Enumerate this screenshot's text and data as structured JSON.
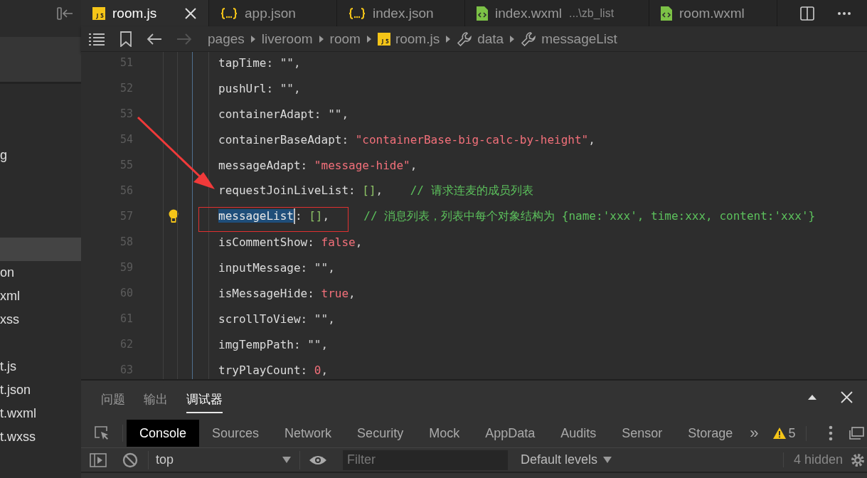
{
  "sidebar": {
    "rows": [
      {
        "label": "g",
        "selected": false
      },
      {
        "selected": true
      },
      {
        "label": "on",
        "selected": false
      },
      {
        "label": "xml",
        "selected": false
      },
      {
        "label": "xss",
        "selected": false
      },
      {
        "label": "t.js",
        "selected": false
      },
      {
        "label": "t.json",
        "selected": false
      },
      {
        "label": "t.wxml",
        "selected": false
      },
      {
        "label": "t.wxss",
        "selected": false
      }
    ]
  },
  "tabs": [
    {
      "label": "room.js",
      "kind": "js",
      "selected": true
    },
    {
      "label": "app.json",
      "kind": "json",
      "selected": false
    },
    {
      "label": "index.json",
      "kind": "json",
      "selected": false
    },
    {
      "label": "index.wxml",
      "detail": "...\\zb_list",
      "kind": "wxml",
      "selected": false
    },
    {
      "label": "room.wxml",
      "kind": "wxml",
      "selected": false
    }
  ],
  "breadcrumb": [
    {
      "label": "pages",
      "kind": "folder"
    },
    {
      "label": "liveroom",
      "kind": "folder"
    },
    {
      "label": "room",
      "kind": "folder"
    },
    {
      "label": "room.js",
      "kind": "js"
    },
    {
      "label": "data",
      "kind": "property"
    },
    {
      "label": "messageList",
      "kind": "property"
    }
  ],
  "editor": {
    "lines": [
      {
        "number": "51",
        "lightbulb": false,
        "tokens": [
          {
            "kind": "key",
            "text": "tapTime"
          },
          {
            "kind": "plain",
            "text": ": "
          },
          {
            "kind": "plain",
            "text": "\"\""
          },
          {
            "kind": "plain",
            "text": ","
          }
        ]
      },
      {
        "number": "52",
        "lightbulb": false,
        "tokens": [
          {
            "kind": "key",
            "text": "pushUrl"
          },
          {
            "kind": "plain",
            "text": ": "
          },
          {
            "kind": "plain",
            "text": "\"\""
          },
          {
            "kind": "plain",
            "text": ","
          }
        ]
      },
      {
        "number": "53",
        "lightbulb": false,
        "tokens": [
          {
            "kind": "key",
            "text": "containerAdapt"
          },
          {
            "kind": "plain",
            "text": ": "
          },
          {
            "kind": "plain",
            "text": "\"\""
          },
          {
            "kind": "plain",
            "text": ","
          }
        ]
      },
      {
        "number": "54",
        "lightbulb": false,
        "tokens": [
          {
            "kind": "key",
            "text": "containerBaseAdapt"
          },
          {
            "kind": "plain",
            "text": ": "
          },
          {
            "kind": "string",
            "text": "\"containerBase-big-calc-by-height\""
          },
          {
            "kind": "plain",
            "text": ","
          }
        ]
      },
      {
        "number": "55",
        "lightbulb": false,
        "tokens": [
          {
            "kind": "key",
            "text": "messageAdapt"
          },
          {
            "kind": "plain",
            "text": ": "
          },
          {
            "kind": "string",
            "text": "\"message-hide\""
          },
          {
            "kind": "plain",
            "text": ","
          }
        ]
      },
      {
        "number": "56",
        "lightbulb": false,
        "tokens": [
          {
            "kind": "key",
            "text": "requestJoinLiveList"
          },
          {
            "kind": "plain",
            "text": ": "
          },
          {
            "kind": "array",
            "text": "[]"
          },
          {
            "kind": "plain",
            "text": ",    "
          },
          {
            "kind": "comment",
            "text": "// 请求连麦的成员列表"
          }
        ]
      },
      {
        "number": "57",
        "lightbulb": true,
        "tokens": [
          {
            "kind": "selection",
            "text": "messageList"
          },
          {
            "kind": "plain",
            "text": ": "
          },
          {
            "kind": "array",
            "text": "[]"
          },
          {
            "kind": "plain",
            "text": ",     "
          },
          {
            "kind": "comment",
            "text": "// 消息列表，列表中每个对象结构为 {name:'xxx', time:xxx, content:'xxx'}"
          }
        ]
      },
      {
        "number": "58",
        "lightbulb": false,
        "tokens": [
          {
            "kind": "key",
            "text": "isCommentShow"
          },
          {
            "kind": "plain",
            "text": ": "
          },
          {
            "kind": "literal",
            "text": "false"
          },
          {
            "kind": "plain",
            "text": ","
          }
        ]
      },
      {
        "number": "59",
        "lightbulb": false,
        "tokens": [
          {
            "kind": "key",
            "text": "inputMessage"
          },
          {
            "kind": "plain",
            "text": ": "
          },
          {
            "kind": "plain",
            "text": "\"\""
          },
          {
            "kind": "plain",
            "text": ","
          }
        ]
      },
      {
        "number": "60",
        "lightbulb": false,
        "tokens": [
          {
            "kind": "key",
            "text": "isMessageHide"
          },
          {
            "kind": "plain",
            "text": ": "
          },
          {
            "kind": "literal",
            "text": "true"
          },
          {
            "kind": "plain",
            "text": ","
          }
        ]
      },
      {
        "number": "61",
        "lightbulb": false,
        "tokens": [
          {
            "kind": "key",
            "text": "scrollToView"
          },
          {
            "kind": "plain",
            "text": ": "
          },
          {
            "kind": "plain",
            "text": "\"\""
          },
          {
            "kind": "plain",
            "text": ","
          }
        ]
      },
      {
        "number": "62",
        "lightbulb": false,
        "tokens": [
          {
            "kind": "key",
            "text": "imgTempPath"
          },
          {
            "kind": "plain",
            "text": ": "
          },
          {
            "kind": "plain",
            "text": "\"\""
          },
          {
            "kind": "plain",
            "text": ","
          }
        ]
      },
      {
        "number": "63",
        "lightbulb": false,
        "tokens": [
          {
            "kind": "key",
            "text": "tryPlayCount"
          },
          {
            "kind": "plain",
            "text": ": "
          },
          {
            "kind": "literal",
            "text": "0"
          },
          {
            "kind": "plain",
            "text": ","
          }
        ]
      }
    ],
    "annotations": [
      {
        "kind": "arrow"
      },
      {
        "kind": "box"
      }
    ]
  },
  "panel": {
    "tabs": [
      {
        "label": "问题",
        "selected": false
      },
      {
        "label": "输出",
        "selected": false
      },
      {
        "label": "调试器",
        "selected": true
      }
    ],
    "devtools_tabs": [
      {
        "label": "Console",
        "selected": true
      },
      {
        "label": "Sources",
        "selected": false
      },
      {
        "label": "Network",
        "selected": false
      },
      {
        "label": "Security",
        "selected": false
      },
      {
        "label": "Mock",
        "selected": false
      },
      {
        "label": "AppData",
        "selected": false
      },
      {
        "label": "Audits",
        "selected": false
      },
      {
        "label": "Sensor",
        "selected": false
      },
      {
        "label": "Storage",
        "selected": false
      }
    ],
    "more": "»",
    "warnings": "5",
    "console": {
      "context": "top",
      "filter_placeholder": "Filter",
      "levels": "Default levels",
      "hidden": "4 hidden"
    }
  }
}
